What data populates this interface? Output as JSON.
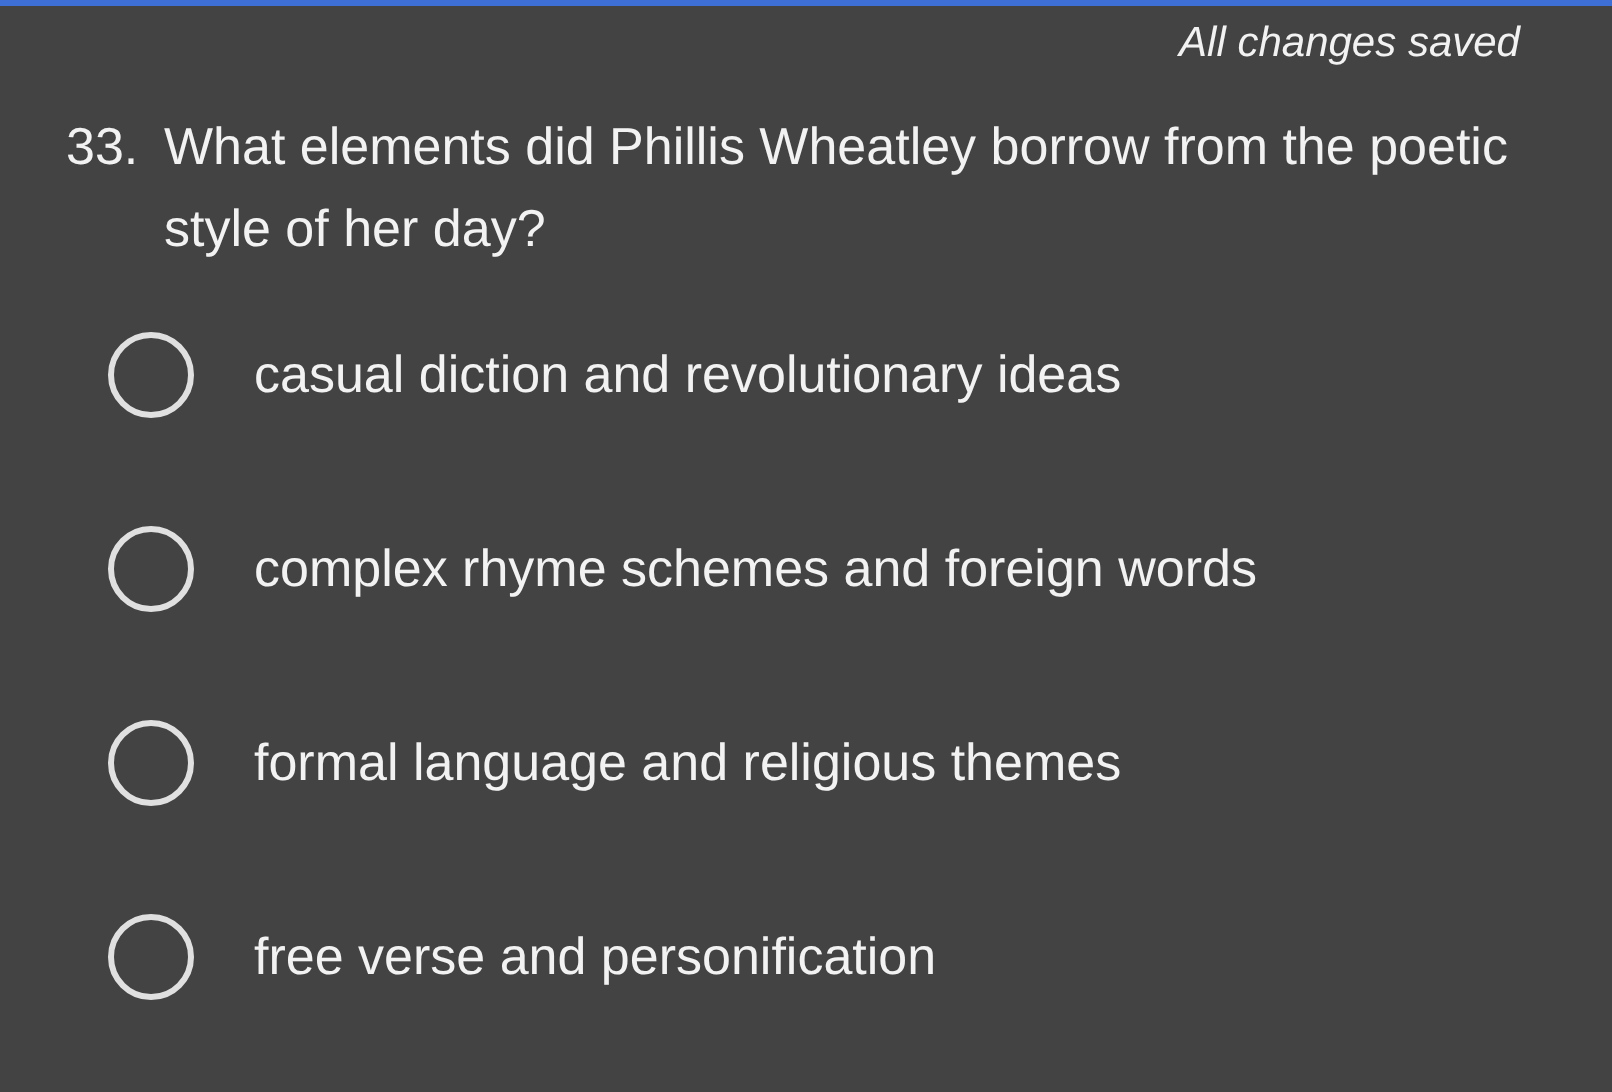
{
  "status": "All changes saved",
  "question": {
    "number": "33.",
    "text": "What elements did Phillis Wheatley borrow from the poetic style of her day?"
  },
  "options": [
    {
      "label": "casual diction and revolutionary ideas",
      "selected": false
    },
    {
      "label": "complex rhyme schemes and foreign words",
      "selected": false
    },
    {
      "label": "formal language and religious themes",
      "selected": false
    },
    {
      "label": "free verse and personification",
      "selected": false
    }
  ]
}
